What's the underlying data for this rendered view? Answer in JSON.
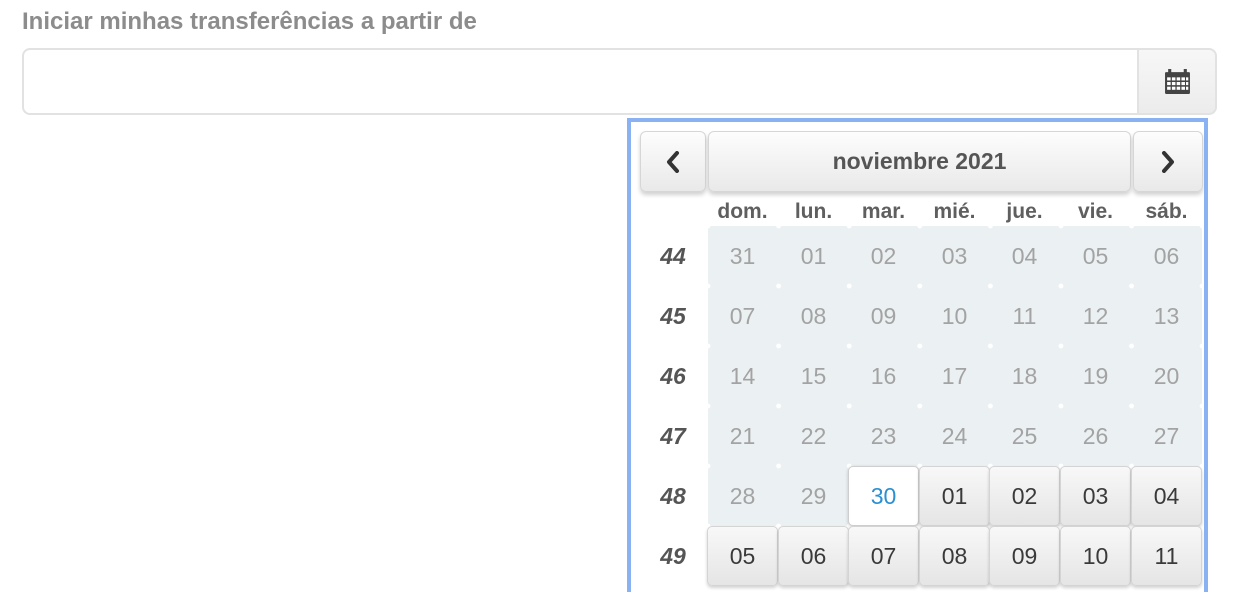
{
  "field": {
    "label": "Iniciar minhas transferências a partir de",
    "value": "",
    "calendar_button_icon": "calendar-icon"
  },
  "datepicker": {
    "prev_icon": "chevron-left-icon",
    "next_icon": "chevron-right-icon",
    "month_title": "noviembre 2021",
    "weekdays": [
      "dom.",
      "lun.",
      "mar.",
      "mié.",
      "jue.",
      "vie.",
      "sáb."
    ],
    "weeks": [
      {
        "number": "44",
        "days": [
          "31",
          "01",
          "02",
          "03",
          "04",
          "05",
          "06"
        ]
      },
      {
        "number": "45",
        "days": [
          "07",
          "08",
          "09",
          "10",
          "11",
          "12",
          "13"
        ]
      },
      {
        "number": "46",
        "days": [
          "14",
          "15",
          "16",
          "17",
          "18",
          "19",
          "20"
        ]
      },
      {
        "number": "47",
        "days": [
          "21",
          "22",
          "23",
          "24",
          "25",
          "26",
          "27"
        ]
      },
      {
        "number": "48",
        "days": [
          "28",
          "29",
          "30",
          "01",
          "02",
          "03",
          "04"
        ]
      },
      {
        "number": "49",
        "days": [
          "05",
          "06",
          "07",
          "08",
          "09",
          "10",
          "11"
        ]
      }
    ],
    "today": "30",
    "colors": {
      "today": "#2b8fd2",
      "focus_border": "#8ab1f2",
      "disabled_bg": "#ebf0f2"
    }
  }
}
